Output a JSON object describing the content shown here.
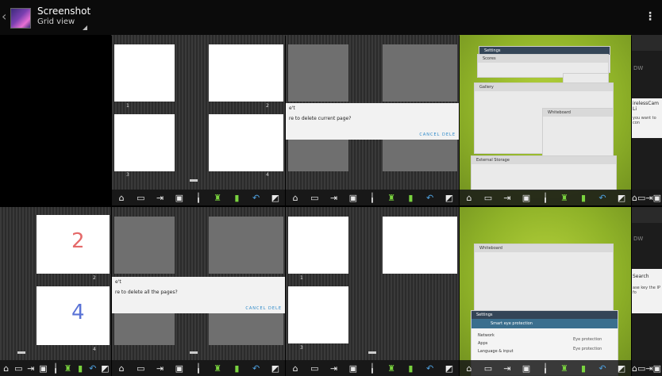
{
  "header": {
    "back_glyph": "‹",
    "title": "Screenshot",
    "subtitle": "Grid view",
    "overflow_glyph": "⋮"
  },
  "toolbar_icons": [
    "home-icon",
    "window-icon",
    "exit-icon",
    "screen-icon",
    "pen-icon",
    "brush-icon",
    "marker-icon",
    "undo-icon",
    "eraser-icon"
  ],
  "toolbar_glyphs": {
    "home-icon": "⌂",
    "window-icon": "▭",
    "exit-icon": "⇥",
    "screen-icon": "▣",
    "pen-icon": "╽",
    "brush-icon": "♜",
    "marker-icon": "▮",
    "undo-icon": "↶",
    "eraser-icon": "◩"
  },
  "cells": {
    "r1c2": {
      "nums": [
        "1",
        "2",
        "3",
        "4"
      ]
    },
    "r1c3": {
      "dialog_title": "e't",
      "dialog_text": "re to delete current page?",
      "dialog_buttons": "CANCEL   DELE"
    },
    "r1c4": {
      "cards": [
        "Settings",
        "Scores",
        "Gallery",
        "Whiteboard",
        "External Storage"
      ]
    },
    "r1c5": {
      "text1": "DW",
      "text2": "irelessCam Li",
      "text3": "you want to con"
    },
    "r2c1": {
      "digit_top": "2",
      "digit_bottom": "4",
      "num1": "2",
      "num2": "4"
    },
    "r2c2": {
      "dialog_title": "e't",
      "dialog_text": "re to delete all the pages?",
      "dialog_buttons": "CANCEL   DELE"
    },
    "r2c3": {
      "num1": "1",
      "num2": "3"
    },
    "r2c4": {
      "card1": "Whiteboard",
      "card2": "Settings",
      "card2_sub": "Smart eye protection",
      "list": [
        "Network",
        "Apps",
        "Language & input"
      ],
      "right": [
        "Eye protection",
        "Eye protection"
      ]
    },
    "r2c5": {
      "text1": "DW",
      "text2": "Search",
      "text3": "ase key the IP fo"
    }
  }
}
